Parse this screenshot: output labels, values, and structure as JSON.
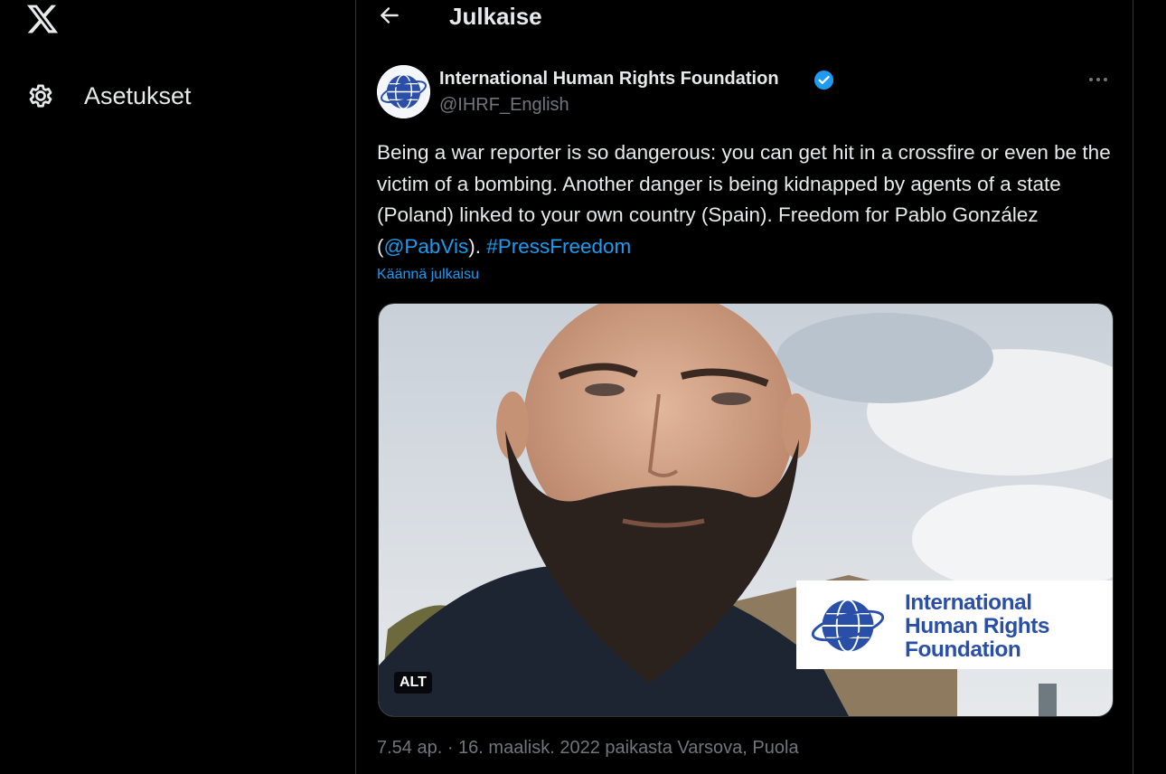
{
  "sidebar": {
    "logo_icon": "x-logo-icon",
    "items": [
      {
        "icon": "gear-icon",
        "label": "Asetukset"
      }
    ]
  },
  "header": {
    "back_icon": "arrow-left-icon",
    "title": "Julkaise"
  },
  "tweet": {
    "author_name": "International Human Rights Foundation",
    "handle": "@IHRF_English",
    "verified_color": "#1d9bf0",
    "text_parts": {
      "p1": "Being a war reporter is so dangerous: you can get hit in a crossfire or even be the victim of a bombing. Another danger is being kidnapped by agents of a state (Poland) linked to your own country (Spain). Freedom for Pablo González (",
      "mention": "@PabVis",
      "p2": "). ",
      "hashtag": "#PressFreedom"
    },
    "translate_label": "Käännä julkaisu",
    "media": {
      "alt_badge": "ALT",
      "logo_lines": [
        "International",
        "Human Rights",
        "Foundation"
      ],
      "logo_color": "#2a4fa8"
    },
    "meta": "7.54 ap. · 16. maalisk. 2022 paikasta Varsova, Puola"
  },
  "colors": {
    "background": "#000000",
    "text": "#e7e9ea",
    "muted": "#71767b",
    "link": "#1d9bf0",
    "border": "#2f3336"
  }
}
